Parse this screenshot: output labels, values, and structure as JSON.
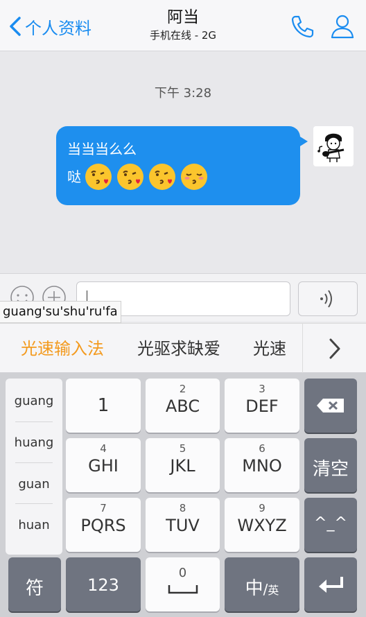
{
  "header": {
    "back_label": "个人资料",
    "title": "阿当",
    "subtitle": "手机在线 - 2G",
    "accent": "#1a8cf0"
  },
  "chat": {
    "timestamp": "下午 3:28",
    "message": {
      "line1": "当当当么么",
      "line2_text": "哒",
      "emojis": [
        "kissing-heart-emoji",
        "kissing-heart-emoji",
        "kissing-heart-emoji",
        "kissing-closed-eyes-emoji"
      ],
      "bubble_color": "#1e8fee"
    }
  },
  "input_bar": {
    "composing_pinyin": "guang'su'shu'ru'fa"
  },
  "candidates": {
    "items": [
      "光速输入法",
      "光驱求缺爱",
      "光速"
    ],
    "highlight_color": "#f39a1e"
  },
  "keyboard": {
    "pinyin_options": [
      "guang",
      "huang",
      "guan",
      "huan"
    ],
    "keys": {
      "k1": {
        "num": "",
        "letters": "1"
      },
      "k2": {
        "num": "2",
        "letters": "ABC"
      },
      "k3": {
        "num": "3",
        "letters": "DEF"
      },
      "k4": {
        "num": "4",
        "letters": "GHI"
      },
      "k5": {
        "num": "5",
        "letters": "JKL"
      },
      "k6": {
        "num": "6",
        "letters": "MNO"
      },
      "k7": {
        "num": "7",
        "letters": "PQRS"
      },
      "k8": {
        "num": "8",
        "letters": "TUV"
      },
      "k9": {
        "num": "9",
        "letters": "WXYZ"
      },
      "k0": {
        "num": "0"
      }
    },
    "clear_label": "清空",
    "emoticon_label": "^_^",
    "symbol_label": "符",
    "numeric_label": "123",
    "lang_main": "中",
    "lang_sep": "/",
    "lang_alt": "英"
  }
}
